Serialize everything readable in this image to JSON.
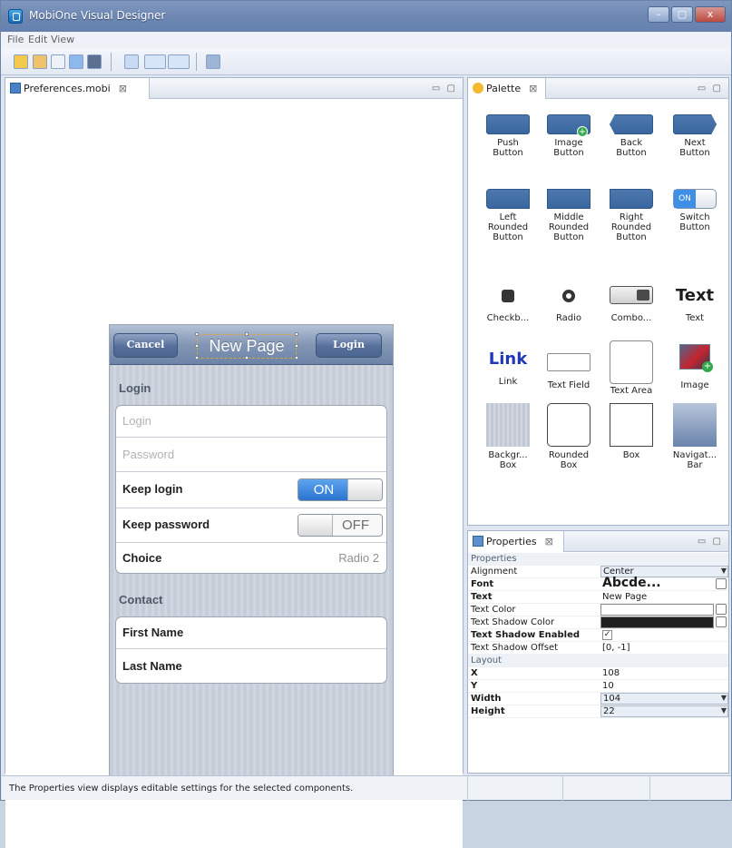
{
  "window": {
    "title": "MobiOne Visual Designer",
    "controls": [
      "–",
      "▢",
      "x"
    ]
  },
  "menu": [
    "File",
    "Edit",
    "View"
  ],
  "editor": {
    "tab": "Preferences.mobi",
    "close": "⊠",
    "view_controls": "▭ ▢"
  },
  "design": {
    "nav": {
      "left_button": "Cancel",
      "title": "New Page",
      "right_button": "Login"
    },
    "login_section": "Login",
    "login_placeholder": "Login",
    "password_placeholder": "Password",
    "keep_login": "Keep login",
    "keep_login_state": "ON",
    "keep_password": "Keep password",
    "keep_password_state": "OFF",
    "choice": "Choice",
    "choice_value": "Radio 2",
    "contact_section": "Contact",
    "first_name": "First Name",
    "last_name": "Last Name"
  },
  "palette": {
    "tab": "Palette",
    "close": "⊠",
    "items": [
      [
        "Push",
        "Button"
      ],
      [
        "Image",
        "Button"
      ],
      [
        "Back",
        "Button"
      ],
      [
        "Next",
        "Button"
      ],
      [
        "Left",
        "Rounded",
        "Button"
      ],
      [
        "Middle",
        "Rounded",
        "Button"
      ],
      [
        "Right",
        "Rounded",
        "Button"
      ],
      [
        "Switch",
        "Button"
      ],
      [
        "Checkb..."
      ],
      [
        "Radio"
      ],
      [
        "Combo..."
      ],
      [
        "Text"
      ],
      [
        "Link"
      ],
      [
        "Text Field"
      ],
      [
        "Text Area"
      ],
      [
        "Image"
      ],
      [
        "Backgr...",
        "Box"
      ],
      [
        "Rounded",
        "Box"
      ],
      [
        "Box"
      ],
      [
        "Navigat...",
        "Bar"
      ]
    ],
    "switch_label": "ON",
    "text_icon": "Text",
    "link_icon": "Link"
  },
  "properties": {
    "tab": "Properties",
    "close": "⊠",
    "group_properties": "Properties",
    "group_layout": "Layout",
    "alignment": "Alignment",
    "alignment_value": "Center",
    "font": "Font",
    "font_value": "Abcde...",
    "text": "Text",
    "text_value": "New Page",
    "text_color": "Text Color",
    "text_shadow_color": "Text Shadow Color",
    "text_shadow_enabled": "Text Shadow Enabled",
    "text_shadow_offset": "Text Shadow Offset",
    "text_shadow_offset_value": "[0, -1]",
    "x": "X",
    "x_value": "108",
    "y": "Y",
    "y_value": "10",
    "width": "Width",
    "width_value": "104",
    "height": "Height",
    "height_value": "22",
    "check": "✓",
    "colors": {
      "text_color": "#ffffff",
      "text_shadow_color": "#202020"
    }
  },
  "status": {
    "text": "The Properties view displays editable settings for the selected components."
  },
  "icons": {
    "app": "mobione-icon",
    "editor_tab": "mobi-file-icon",
    "palette_tab": "palette-icon",
    "properties_tab": "properties-icon"
  }
}
